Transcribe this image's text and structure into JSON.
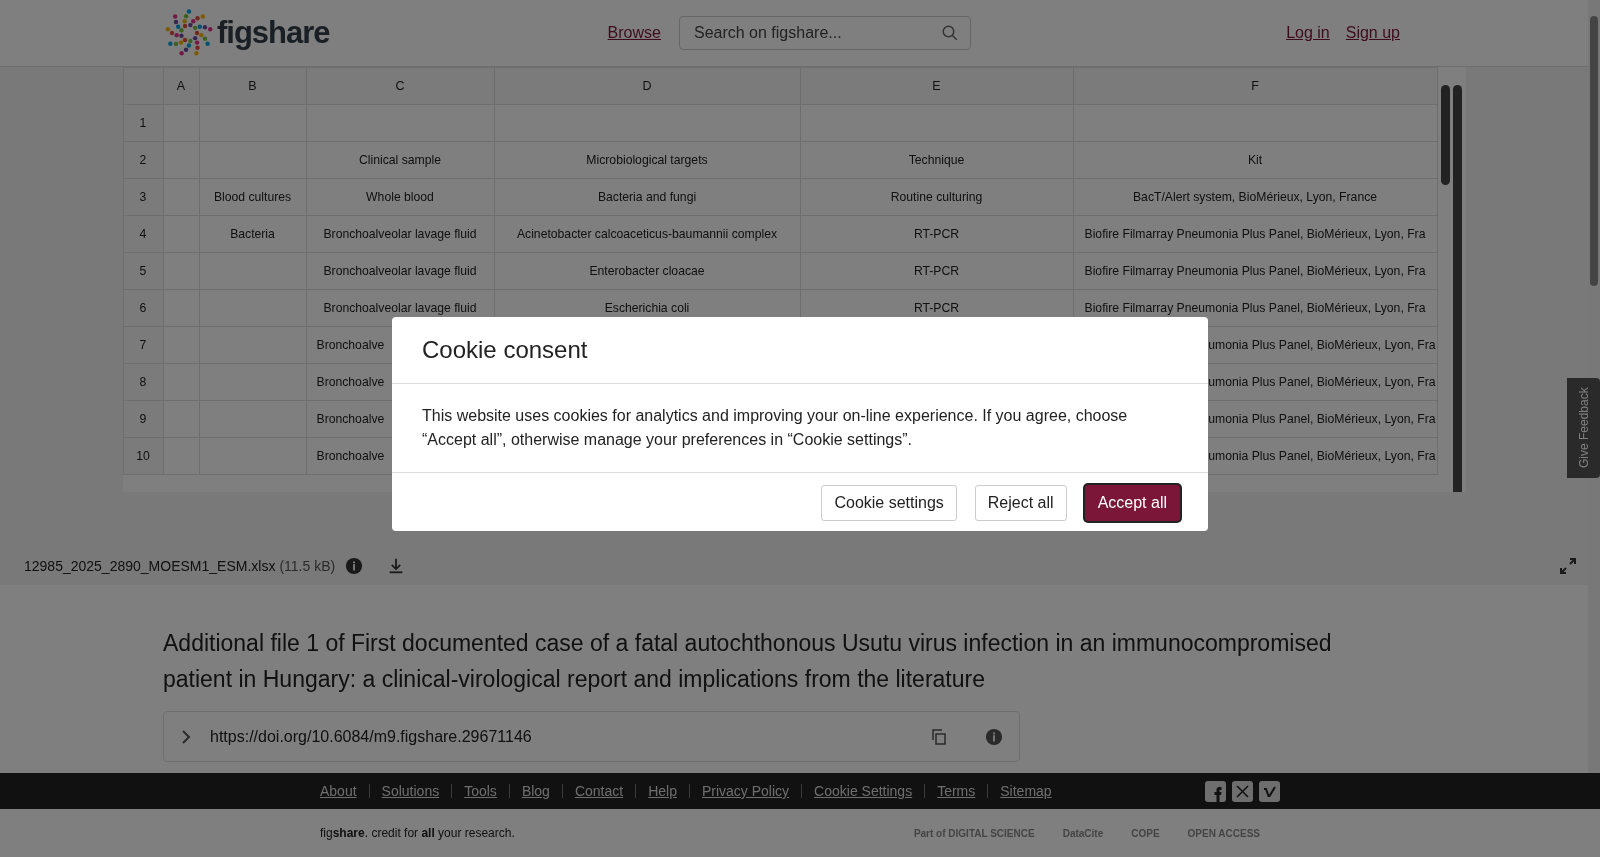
{
  "header": {
    "logo": "figshare",
    "browse": "Browse",
    "search": {
      "placeholder": "Search on figshare..."
    },
    "login": "Log in",
    "signup": "Sign up"
  },
  "sheet": {
    "columns": [
      "A",
      "B",
      "C",
      "D",
      "E",
      "F"
    ],
    "rows": [
      {
        "num": "1",
        "cells": {}
      },
      {
        "num": "2",
        "cells": {
          "C": "Clinical sample",
          "D": "Microbiological targets",
          "E": "Technique",
          "F": "Kit"
        }
      },
      {
        "num": "3",
        "cells": {
          "B": "Blood cultures",
          "C": "Whole blood",
          "D": "Bacteria and fungi",
          "E": "Routine culturing",
          "F": "BacT/Alert system, BioMérieux, Lyon, France"
        }
      },
      {
        "num": "4",
        "cells": {
          "B": "Bacteria",
          "C": "Bronchoalveolar lavage fluid",
          "D": "Acinetobacter calcoaceticus-baumannii complex",
          "E": "RT-PCR",
          "F": "Biofire Filmarray Pneumonia Plus Panel, BioMérieux, Lyon, Fra"
        }
      },
      {
        "num": "5",
        "cells": {
          "C": "Bronchoalveolar lavage fluid",
          "D": "Enterobacter cloacae",
          "E": "RT-PCR",
          "F": "Biofire Filmarray Pneumonia Plus Panel, BioMérieux, Lyon, Fra"
        }
      },
      {
        "num": "6",
        "cells": {
          "C": "Bronchoalveolar lavage fluid",
          "D": "Escherichia coli",
          "E": "RT-PCR",
          "F": "Biofire Filmarray Pneumonia Plus Panel, BioMérieux, Lyon, Fra"
        }
      },
      {
        "num": "7",
        "cells": {
          "C": {
            "text": "Bronchoalve",
            "cut_end": true
          },
          "F": {
            "text": "umonia Plus Panel, BioMérieux, Lyon, Fra",
            "cut_start": true
          }
        }
      },
      {
        "num": "8",
        "cells": {
          "C": {
            "text": "Bronchoalve",
            "cut_end": true
          },
          "F": {
            "text": "umonia Plus Panel, BioMérieux, Lyon, Fra",
            "cut_start": true
          }
        }
      },
      {
        "num": "9",
        "cells": {
          "C": {
            "text": "Bronchoalve",
            "cut_end": true
          },
          "F": {
            "text": "umonia Plus Panel, BioMérieux, Lyon, Fra",
            "cut_start": true
          }
        }
      },
      {
        "num": "10",
        "cells": {
          "C": {
            "text": "Bronchoalve",
            "cut_end": true
          },
          "F": {
            "text": "umonia Plus Panel, BioMérieux, Lyon, Fra",
            "cut_start": true
          }
        }
      }
    ]
  },
  "file_bar": {
    "name": "12985_2025_2890_MOESM1_ESM.xlsx",
    "size": "(11.5 kB)"
  },
  "title": "Additional file 1 of First documented case of a fatal autochthonous Usutu virus infection in an immunocompromised patient in Hungary: a clinical-virological report and implications from the literature",
  "doi": "https://doi.org/10.6084/m9.figshare.29671146",
  "footer": {
    "links": [
      "About",
      "Solutions",
      "Tools",
      "Blog",
      "Contact",
      "Help",
      "Privacy Policy",
      "Cookie Settings",
      "Terms",
      "Sitemap"
    ],
    "tagline": "fig**share**. credit for **all** your research.",
    "partners": [
      "Part of DIGITAL SCIENCE",
      "DataCite",
      "COPE",
      "OPEN ACCESS"
    ]
  },
  "feedback": "Give Feedback",
  "cookie_dialog": {
    "title": "Cookie consent",
    "text": "This website uses cookies for analytics and improving your on-line experience. If you agree, choose “Accept all”, otherwise manage your preferences in “Cookie settings”.",
    "buttons": [
      {
        "label": "Cookie settings",
        "kind": "secondary"
      },
      {
        "label": "Reject all",
        "kind": "secondary"
      },
      {
        "label": "Accept all",
        "kind": "primary"
      }
    ]
  }
}
